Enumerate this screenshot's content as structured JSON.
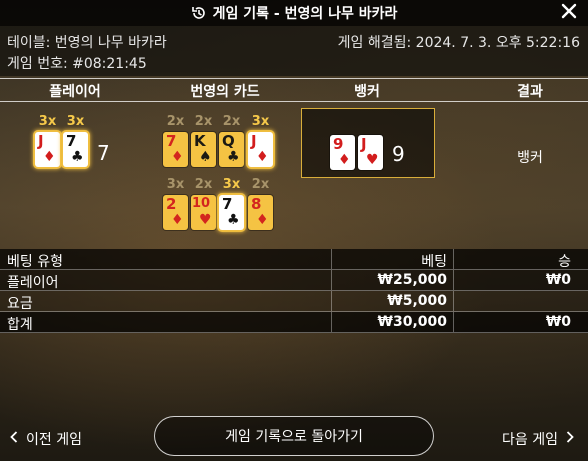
{
  "title_bar": {
    "title": "게임 기록 - 번영의 나무 바카라",
    "history_icon": "history-icon",
    "close_icon": "close-icon"
  },
  "info": {
    "table_label": "테이블: 번영의 나무 바카라",
    "game_number": "게임 번호: #08:21:45",
    "resolved": "게임 해결됨: 2024. 7. 3. 오후 5:22:16"
  },
  "card_table": {
    "headers": {
      "player": "플레이어",
      "prosperity": "번영의 카드",
      "banker": "뱅커",
      "result": "결과"
    },
    "player": {
      "multipliers": [
        "3x",
        "3x"
      ],
      "cards": [
        {
          "rank": "J",
          "suit": "♦"
        },
        {
          "rank": "7",
          "suit": "♣"
        }
      ],
      "score": "7"
    },
    "prosperity_rows": [
      {
        "multipliers": [
          "2x",
          "2x",
          "2x",
          "3x"
        ],
        "cards": [
          {
            "rank": "7",
            "suit": "♦"
          },
          {
            "rank": "K",
            "suit": "♠"
          },
          {
            "rank": "Q",
            "suit": "♣"
          },
          {
            "rank": "J",
            "suit": "♦"
          }
        ]
      },
      {
        "multipliers": [
          "3x",
          "2x",
          "3x",
          "2x"
        ],
        "cards": [
          {
            "rank": "2",
            "suit": "♦"
          },
          {
            "rank": "10",
            "suit": "♥"
          },
          {
            "rank": "7",
            "suit": "♣"
          },
          {
            "rank": "8",
            "suit": "♦"
          }
        ]
      }
    ],
    "banker": {
      "cards": [
        {
          "rank": "9",
          "suit": "♦"
        },
        {
          "rank": "J",
          "suit": "♥"
        }
      ],
      "score": "9"
    },
    "result": "뱅커"
  },
  "bet_table": {
    "headers": {
      "type": "베팅 유형",
      "bet": "베팅",
      "win": "승"
    },
    "rows": [
      {
        "type": "플레이어",
        "bet": "₩25,000",
        "win": "₩0"
      },
      {
        "type": "요금",
        "bet": "₩5,000",
        "win": ""
      }
    ],
    "total": {
      "type": "합계",
      "bet": "₩30,000",
      "win": "₩0"
    }
  },
  "footer": {
    "prev_label": "이전 게임",
    "back_label": "게임 기록으로 돌아가기",
    "next_label": "다음 게임",
    "prev_icon": "chevron-left-icon",
    "next_icon": "chevron-right-icon"
  },
  "colors": {
    "accent_gold": "#f5c343",
    "red_suit": "#d21d1d",
    "black_suit": "#111111"
  }
}
